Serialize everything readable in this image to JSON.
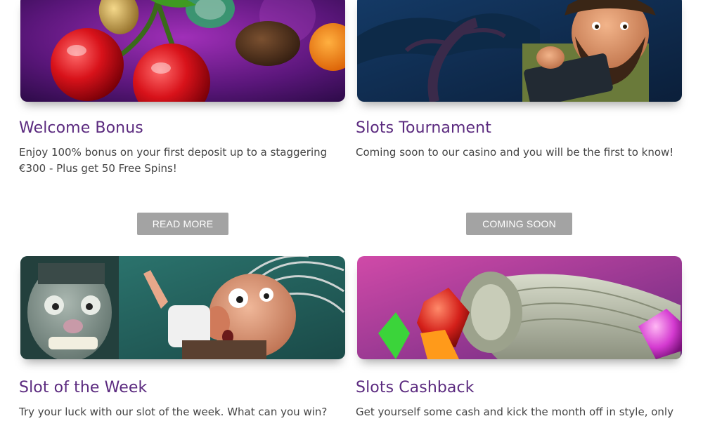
{
  "promos": [
    {
      "title": "Welcome Bonus",
      "description": "Enjoy 100% bonus on your first deposit up to a staggering €300 - Plus get 50 Free Spins!",
      "button": "READ MORE",
      "banner": "cherries-coins-banner",
      "colors": {
        "bg_from": "#3a0f5c",
        "bg_to": "#7a1fa0"
      }
    },
    {
      "title": "Slots Tournament",
      "description": "Coming soon to our casino and you will be the first to know!",
      "button": "COMING SOON",
      "banner": "gonzo-banner",
      "colors": {
        "bg_from": "#0e2a4f",
        "bg_to": "#1f5a86"
      }
    },
    {
      "title": "Slot of the Week",
      "description": "Try your luck with our slot of the week. What can you win?",
      "banner": "mad-scientist-banner",
      "colors": {
        "bg_from": "#2d6c68",
        "bg_to": "#1d4d4a"
      }
    },
    {
      "title": "Slots Cashback",
      "description": "Get yourself some cash and kick the month off in style, only with",
      "banner": "money-roll-gems-banner",
      "colors": {
        "bg_from": "#c24fa6",
        "bg_to": "#7a2a86"
      }
    }
  ],
  "theme": {
    "title_color": "#5b2a7f",
    "text_color": "#444444",
    "button_color": "#a3a3a3"
  }
}
